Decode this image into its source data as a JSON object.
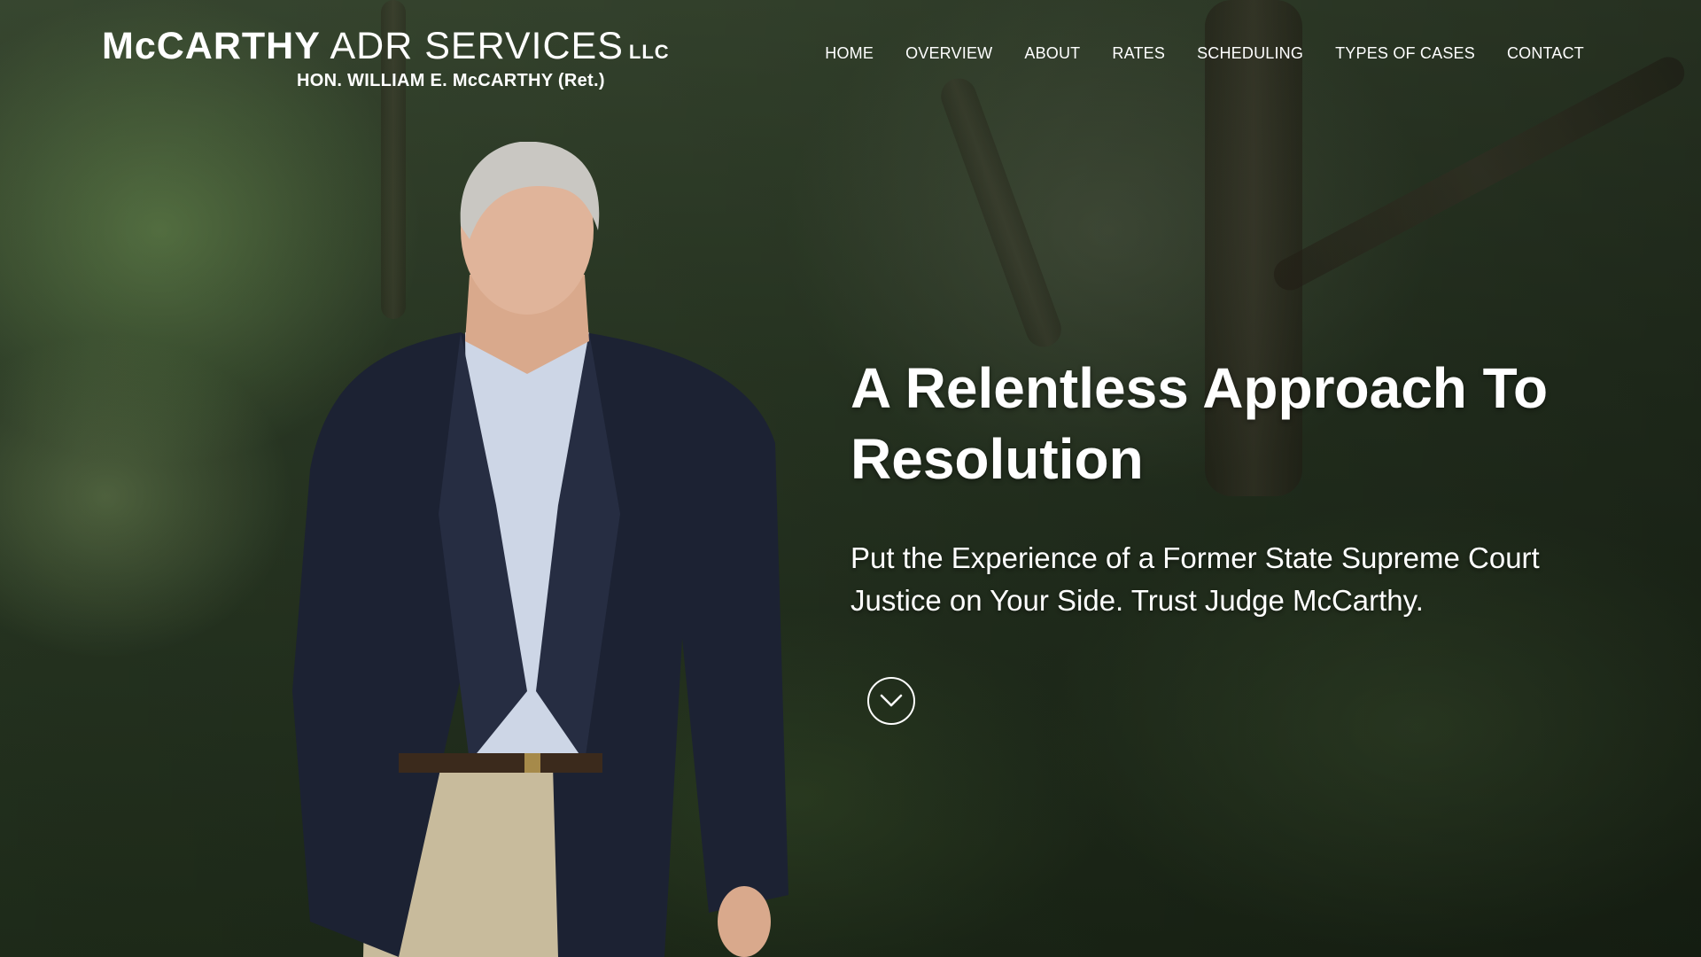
{
  "header": {
    "logo": {
      "name_bold": "McCARTHY",
      "name_light": "ADR SERVICES",
      "suffix": "LLC",
      "subtitle": "HON. WILLIAM E. McCARTHY (Ret.)"
    },
    "nav": [
      {
        "label": "HOME"
      },
      {
        "label": "OVERVIEW"
      },
      {
        "label": "ABOUT"
      },
      {
        "label": "RATES"
      },
      {
        "label": "SCHEDULING"
      },
      {
        "label": "TYPES OF CASES"
      },
      {
        "label": "CONTACT"
      }
    ]
  },
  "hero": {
    "headline": "A Relentless Approach To Resolution",
    "subheadline": "Put the Experience of a Former State Supreme Court Justice on Your Side. Trust Judge McCarthy.",
    "scroll_icon": "chevron-down-icon",
    "background": "forest-photo"
  },
  "colors": {
    "text": "#ffffff",
    "jacket": "#1c2233",
    "shirt": "#cdd6e6",
    "pants": "#c8bb9c"
  }
}
